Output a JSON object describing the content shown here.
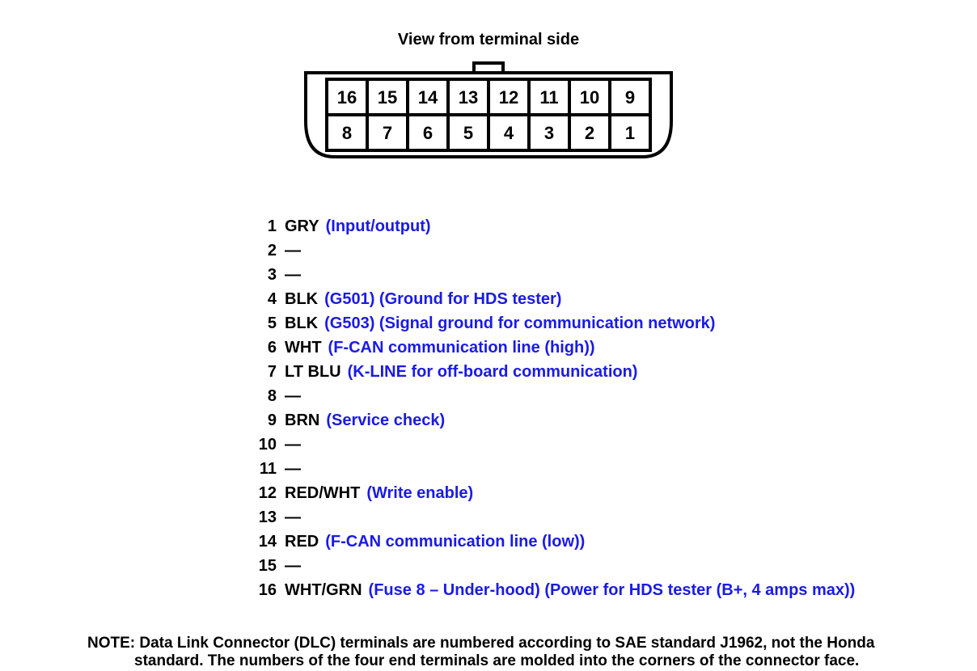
{
  "title": "View from terminal side",
  "connector": {
    "top_row": [
      "16",
      "15",
      "14",
      "13",
      "12",
      "11",
      "10",
      "9"
    ],
    "bottom_row": [
      "8",
      "7",
      "6",
      "5",
      "4",
      "3",
      "2",
      "1"
    ]
  },
  "pins": [
    {
      "num": "1",
      "color": "GRY",
      "desc": "(Input/output)"
    },
    {
      "num": "2",
      "color": "",
      "desc": ""
    },
    {
      "num": "3",
      "color": "",
      "desc": ""
    },
    {
      "num": "4",
      "color": "BLK",
      "desc": "(G501) (Ground for HDS tester)"
    },
    {
      "num": "5",
      "color": "BLK",
      "desc": "(G503) (Signal ground for communication network)"
    },
    {
      "num": "6",
      "color": "WHT",
      "desc": "(F-CAN communication line (high))"
    },
    {
      "num": "7",
      "color": "LT BLU",
      "desc": "(K-LINE for off-board communication)"
    },
    {
      "num": "8",
      "color": "",
      "desc": ""
    },
    {
      "num": "9",
      "color": "BRN",
      "desc": "(Service check)"
    },
    {
      "num": "10",
      "color": "",
      "desc": ""
    },
    {
      "num": "11",
      "color": "",
      "desc": ""
    },
    {
      "num": "12",
      "color": "RED/WHT",
      "desc": "(Write enable)"
    },
    {
      "num": "13",
      "color": "",
      "desc": ""
    },
    {
      "num": "14",
      "color": "RED",
      "desc": "(F-CAN communication line (low))"
    },
    {
      "num": "15",
      "color": "",
      "desc": ""
    },
    {
      "num": "16",
      "color": "WHT/GRN",
      "desc": "(Fuse 8 – Under-hood) (Power for HDS tester (B+, 4 amps max))"
    }
  ],
  "note": {
    "label": "NOTE:",
    "line1": "Data Link Connector (DLC) terminals are numbered according to SAE standard J1962, not the Honda",
    "line2": "standard. The numbers of the four end terminals are molded into the corners of the connector face."
  },
  "empty_marker": "—"
}
